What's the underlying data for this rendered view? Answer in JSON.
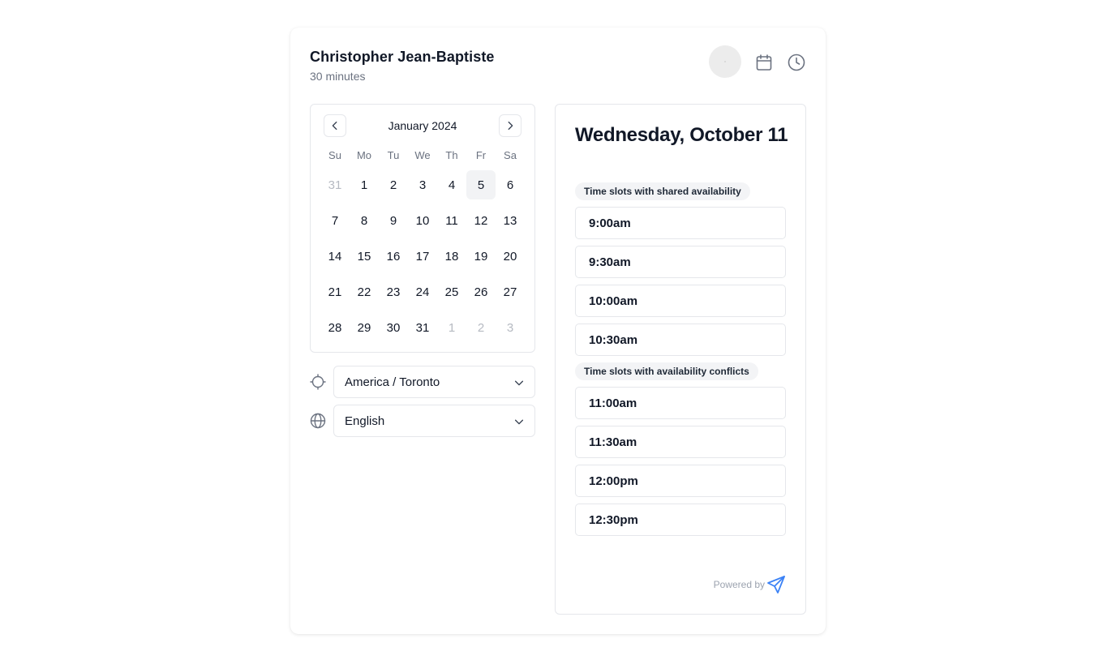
{
  "header": {
    "host_name": "Christopher Jean-Baptiste",
    "duration": "30 minutes",
    "icons": [
      "avatar",
      "calendar-icon",
      "clock-icon"
    ]
  },
  "calendar": {
    "month_label": "January 2024",
    "weekdays": [
      "Su",
      "Mo",
      "Tu",
      "We",
      "Th",
      "Fr",
      "Sa"
    ],
    "days": [
      {
        "label": "31",
        "muted": true
      },
      {
        "label": "1"
      },
      {
        "label": "2"
      },
      {
        "label": "3"
      },
      {
        "label": "4"
      },
      {
        "label": "5",
        "selected": true
      },
      {
        "label": "6"
      },
      {
        "label": "7"
      },
      {
        "label": "8"
      },
      {
        "label": "9"
      },
      {
        "label": "10"
      },
      {
        "label": "11"
      },
      {
        "label": "12"
      },
      {
        "label": "13"
      },
      {
        "label": "14"
      },
      {
        "label": "15"
      },
      {
        "label": "16"
      },
      {
        "label": "17"
      },
      {
        "label": "18"
      },
      {
        "label": "19"
      },
      {
        "label": "20"
      },
      {
        "label": "21"
      },
      {
        "label": "22"
      },
      {
        "label": "23"
      },
      {
        "label": "24"
      },
      {
        "label": "25"
      },
      {
        "label": "26"
      },
      {
        "label": "27"
      },
      {
        "label": "28"
      },
      {
        "label": "29"
      },
      {
        "label": "30"
      },
      {
        "label": "31"
      },
      {
        "label": "1",
        "muted": true
      },
      {
        "label": "2",
        "muted": true
      },
      {
        "label": "3",
        "muted": true
      }
    ]
  },
  "settings": {
    "timezone": "America / Toronto",
    "language": "English"
  },
  "slots": {
    "date_heading": "Wednesday, October 11",
    "shared_label": "Time slots with shared availability",
    "shared": [
      "9:00am",
      "9:30am",
      "10:00am",
      "10:30am"
    ],
    "conflict_label": "Time slots with availability conflicts",
    "conflicts": [
      "11:00am",
      "11:30am",
      "12:00pm",
      "12:30pm"
    ]
  },
  "footer": {
    "powered_by": "Powered by"
  },
  "colors": {
    "accent": "#3b82f6",
    "border": "#e5e7eb",
    "muted_text": "#6b7280",
    "selected_day_bg": "#f2f3f5"
  }
}
